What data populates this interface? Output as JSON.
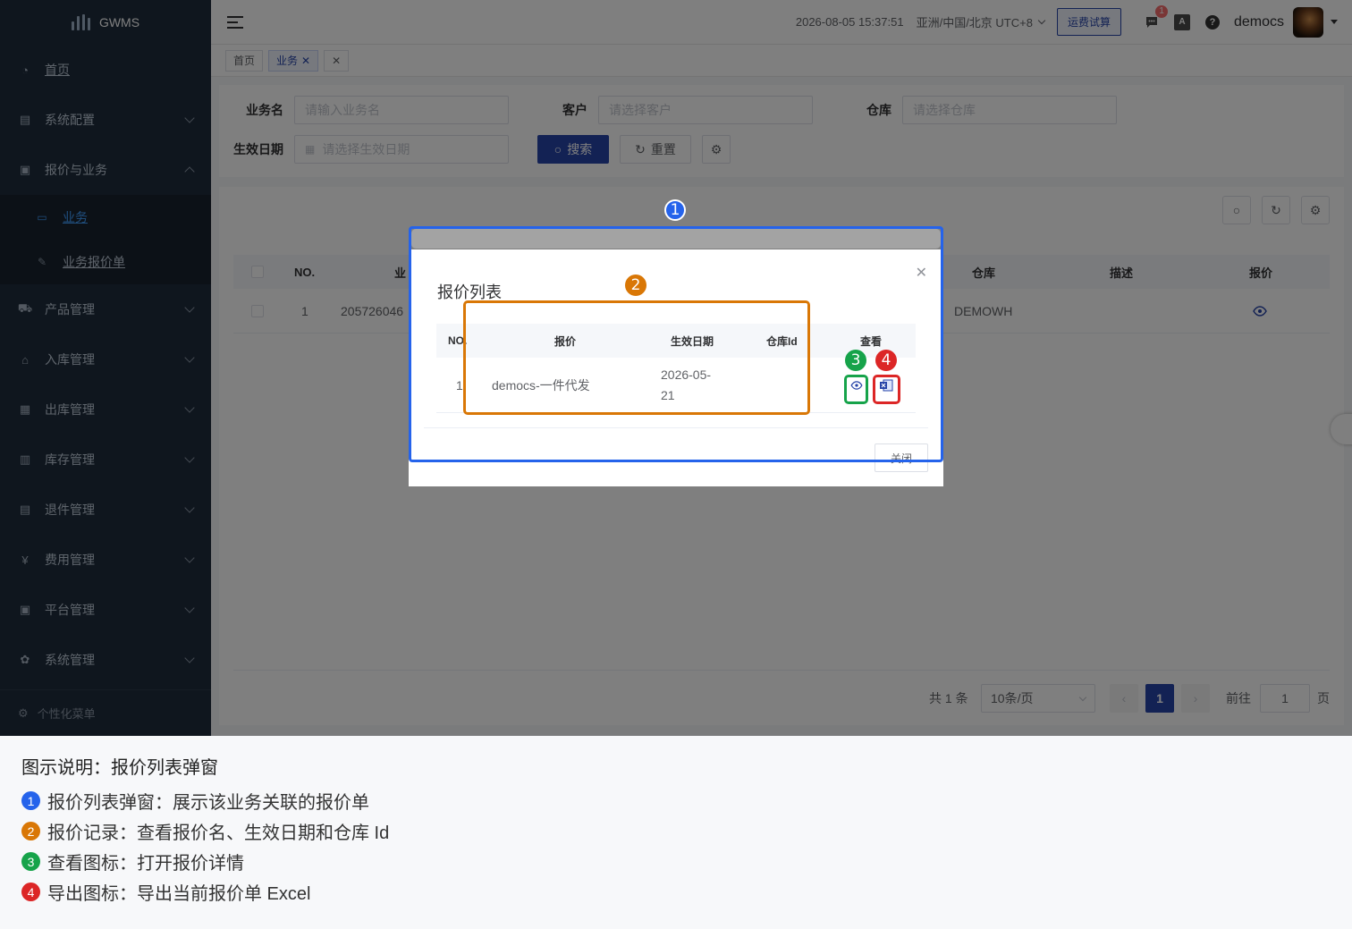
{
  "app": {
    "name": "GWMS"
  },
  "sidebar": {
    "items": [
      {
        "label": "首页",
        "icon": "dashboard-icon",
        "expandable": false
      },
      {
        "label": "系统配置",
        "icon": "config-icon",
        "expandable": true
      },
      {
        "label": "报价与业务",
        "icon": "quote-icon",
        "expandable": true,
        "expanded": true
      },
      {
        "label": "产品管理",
        "icon": "cart-icon",
        "expandable": true
      },
      {
        "label": "入库管理",
        "icon": "home-icon",
        "expandable": true
      },
      {
        "label": "出库管理",
        "icon": "grid-icon",
        "expandable": true
      },
      {
        "label": "库存管理",
        "icon": "table-icon",
        "expandable": true
      },
      {
        "label": "退件管理",
        "icon": "return-icon",
        "expandable": true
      },
      {
        "label": "费用管理",
        "icon": "yen-icon",
        "expandable": true
      },
      {
        "label": "平台管理",
        "icon": "store-icon",
        "expandable": true
      },
      {
        "label": "系统管理",
        "icon": "gear-icon",
        "expandable": true
      }
    ],
    "sub_items": [
      {
        "label": "业务",
        "active": true
      },
      {
        "label": "业务报价单",
        "active": false
      }
    ],
    "personal_menu": "个性化菜单"
  },
  "topbar": {
    "datetime": "2026-08-05 15:37:51",
    "timezone": "亚洲/中国/北京 UTC+8",
    "freight_button": "运费试算",
    "message_count": "1",
    "lang_icon_text": "A",
    "username": "democs"
  },
  "tags": [
    {
      "label": "首页",
      "active": false
    },
    {
      "label": "业务",
      "active": true
    }
  ],
  "search": {
    "business_name_label": "业务名",
    "business_name_placeholder": "请输入业务名",
    "customer_label": "客户",
    "customer_placeholder": "请选择客户",
    "warehouse_label": "仓库",
    "warehouse_placeholder": "请选择仓库",
    "effective_date_label": "生效日期",
    "effective_date_placeholder": "请选择生效日期",
    "search_button": "搜索",
    "reset_button": "重置"
  },
  "table": {
    "columns": {
      "no": "NO.",
      "business": "业",
      "warehouse": "仓库",
      "description": "描述",
      "quote": "报价"
    },
    "rows": [
      {
        "no": "1",
        "business": "205726046",
        "warehouse": "DEMOWH",
        "description": ""
      }
    ]
  },
  "pagination": {
    "total": "共 1 条",
    "page_size": "10条/页",
    "current_page": "1",
    "goto_label": "前往",
    "goto_value": "1",
    "page_suffix": "页"
  },
  "dialog": {
    "title": "报价列表",
    "columns": {
      "no": "NO.",
      "quote": "报价",
      "effective_date": "生效日期",
      "warehouse_id": "仓库Id",
      "view": "查看"
    },
    "rows": [
      {
        "no": "1",
        "quote": "democs-一件代发",
        "effective_date_line1": "2026-05-",
        "effective_date_line2": "21",
        "warehouse_id": ""
      }
    ],
    "close_button": "关闭"
  },
  "callouts": {
    "markers": [
      "1",
      "2",
      "3",
      "4"
    ],
    "colors": {
      "c1": "#2563eb",
      "c2": "#d97706",
      "c3": "#16a34a",
      "c4": "#dc2626"
    }
  },
  "caption": {
    "title": "图示说明：报价列表弹窗",
    "lines": [
      {
        "num": "1",
        "text": "报价列表弹窗：展示该业务关联的报价单"
      },
      {
        "num": "2",
        "text": "报价记录：查看报价名、生效日期和仓库 Id"
      },
      {
        "num": "3",
        "text": "查看图标：打开报价详情"
      },
      {
        "num": "4",
        "text": "导出图标：导出当前报价单 Excel"
      }
    ]
  }
}
